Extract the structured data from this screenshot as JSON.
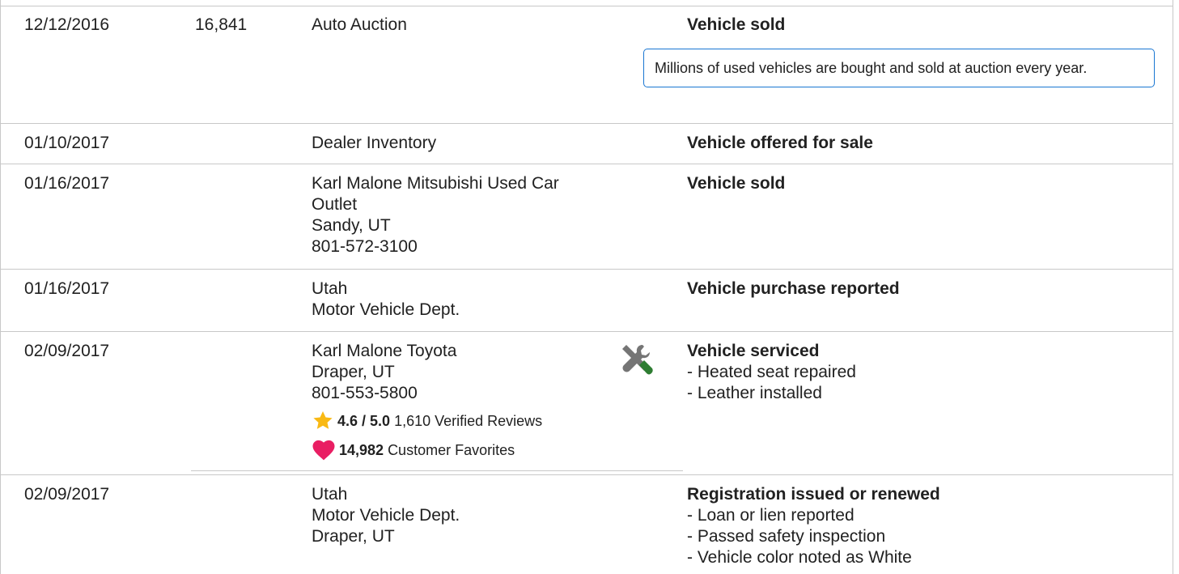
{
  "rows": [
    {
      "date": "12/12/2016",
      "odometer": "16,841",
      "source": [
        "Auto Auction"
      ],
      "title": "Vehicle sold",
      "callout": "Millions of used vehicles are bought and sold at auction every year."
    },
    {
      "date": "01/10/2017",
      "source": [
        "Dealer Inventory"
      ],
      "title": "Vehicle offered for sale"
    },
    {
      "date": "01/16/2017",
      "source": [
        "Karl Malone Mitsubishi Used Car",
        "Outlet",
        "Sandy, UT",
        "801-572-3100"
      ],
      "title": "Vehicle sold"
    },
    {
      "date": "01/16/2017",
      "source": [
        "Utah",
        "Motor Vehicle Dept."
      ],
      "title": "Vehicle purchase reported"
    },
    {
      "date": "02/09/2017",
      "source": [
        "Karl Malone Toyota",
        "Draper, UT",
        "801-553-5800"
      ],
      "rating": "4.6 / 5.0",
      "reviews": "1,610 Verified Reviews",
      "favorites_count": "14,982",
      "favorites_label": "Customer Favorites",
      "icon": "service-tools-icon",
      "title": "Vehicle serviced",
      "details": [
        "- Heated seat repaired",
        "- Leather installed"
      ]
    },
    {
      "date": "02/09/2017",
      "source": [
        "Utah",
        "Motor Vehicle Dept.",
        "Draper, UT"
      ],
      "title": "Registration issued or renewed",
      "details": [
        "- Loan or lien reported",
        "- Passed safety inspection",
        "- Vehicle color noted as White"
      ]
    }
  ],
  "colors": {
    "callout_border": "#1976d2",
    "star": "#f9b914",
    "heart": "#e91e63",
    "wrench": "#757575",
    "screwdriver": "#2e7d32",
    "rule": "#c8c8c8"
  }
}
